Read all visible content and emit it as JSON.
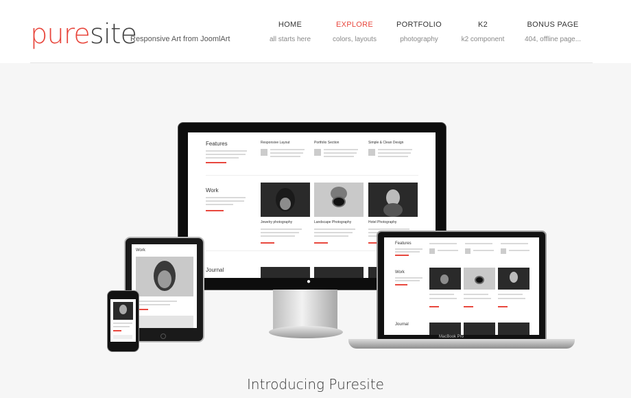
{
  "logo": {
    "pure": "pure",
    "site": "site"
  },
  "tagline": "Responsive Art from JoomlArt",
  "nav": [
    {
      "title": "HOME",
      "sub": "all starts here",
      "active": false
    },
    {
      "title": "EXPLORE",
      "sub": "colors, layouts",
      "active": true
    },
    {
      "title": "PORTFOLIO",
      "sub": "photography",
      "active": false
    },
    {
      "title": "K2",
      "sub": "k2 component",
      "active": false
    },
    {
      "title": "BONUS PAGE",
      "sub": "404, offline page...",
      "active": false
    }
  ],
  "colors": {
    "accent": "#e8473d",
    "text": "#333333",
    "background": "#f6f6f6"
  },
  "mock": {
    "features": "Features",
    "work": "Work",
    "journal": "Journal",
    "col1": "Responsive Layout",
    "col2": "Portfolio Section",
    "col3": "Simple & Clean Design",
    "cap1": "Jewelry photography",
    "cap2": "Landscape Photography",
    "cap3": "Hotel Photography",
    "laptop_brand": "MacBook Pro"
  },
  "hero": {
    "title": "Introducing Puresite"
  }
}
